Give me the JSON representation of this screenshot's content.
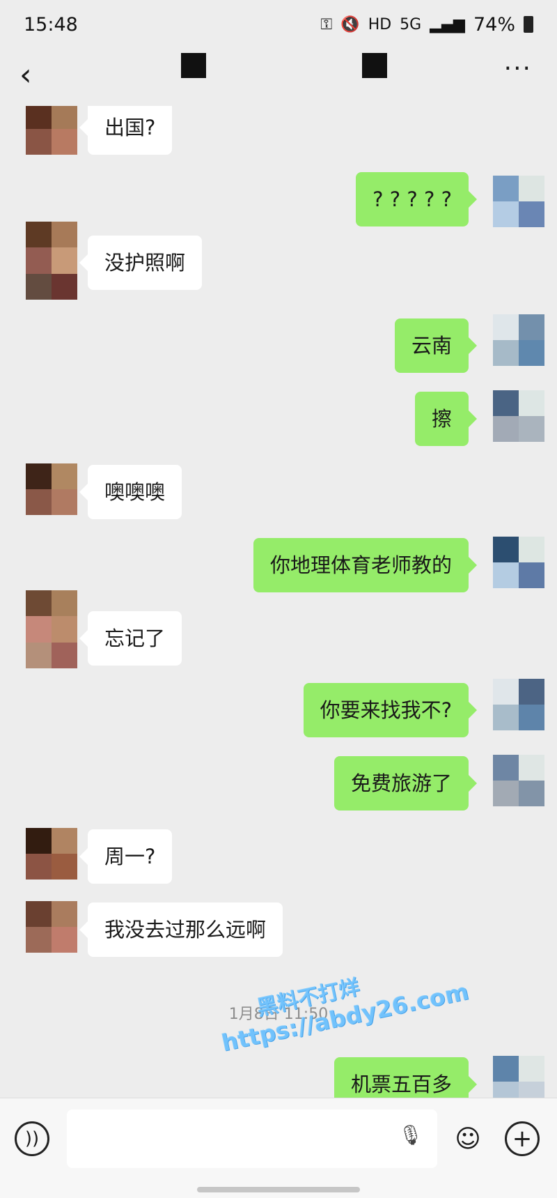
{
  "status_bar": {
    "time": "15:48",
    "icons": [
      "key-icon",
      "mute-icon",
      "hd-icon",
      "5g-icon",
      "signal-icon"
    ],
    "hd": "HD",
    "network": "5G",
    "battery": "74%"
  },
  "nav": {
    "back_icon": "chevron-left-icon",
    "more_icon": "more-icon"
  },
  "messages": [
    {
      "side": "left",
      "text": "出国?"
    },
    {
      "side": "right",
      "text": "? ? ? ? ?"
    },
    {
      "side": "left",
      "text": "没护照啊"
    },
    {
      "side": "right",
      "text": "云南"
    },
    {
      "side": "right",
      "text": "擦"
    },
    {
      "side": "left",
      "text": "噢噢噢"
    },
    {
      "side": "right",
      "text": "你地理体育老师教的"
    },
    {
      "side": "left",
      "text": "忘记了"
    },
    {
      "side": "right",
      "text": "你要来找我不?"
    },
    {
      "side": "right",
      "text": "免费旅游了"
    },
    {
      "side": "left",
      "text": "周一?"
    },
    {
      "side": "left",
      "text": "我没去过那么远啊"
    },
    {
      "side": "right",
      "text": "机票五百多"
    }
  ],
  "timestamp": "1月8日 11:50",
  "watermark": {
    "line1": "黑料不打烊",
    "line2": "https://abdy26.com"
  },
  "composer": {
    "voice_icon": "voice-icon",
    "mic_icon": "mic-icon",
    "emoji_icon": "emoji-icon",
    "plus_icon": "plus-icon"
  },
  "colors": {
    "background": "#ededed",
    "bubble_sent": "#95ec69",
    "bubble_received": "#ffffff"
  }
}
